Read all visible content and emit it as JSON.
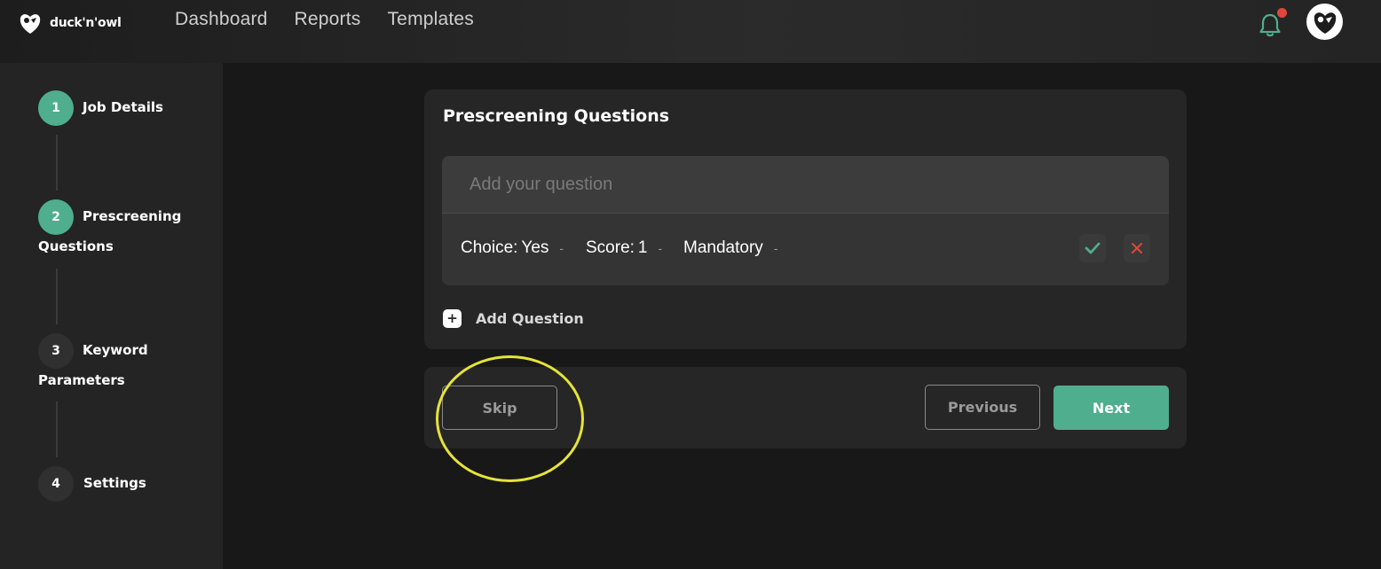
{
  "header": {
    "logo_text": "duck'n'owl",
    "nav": [
      {
        "label": "Dashboard"
      },
      {
        "label": "Reports"
      },
      {
        "label": "Templates"
      }
    ],
    "notification_dot_color": "#e0463c"
  },
  "sidebar": {
    "steps": [
      {
        "number": "1",
        "label": "Job Details",
        "state": "completed"
      },
      {
        "number": "2",
        "label": "Prescreening Questions",
        "state": "current"
      },
      {
        "number": "3",
        "label": "Keyword Parameters",
        "state": "pending"
      },
      {
        "number": "4",
        "label": "Settings",
        "state": "pending"
      }
    ]
  },
  "main": {
    "title": "Prescreening Questions",
    "question": {
      "placeholder": "Add your question",
      "value": "",
      "choice_label": "Choice:",
      "choice_value": "Yes",
      "score_label": "Score:",
      "score_value": "1",
      "mandatory_value": "Mandatory",
      "confirm_icon": "check-icon",
      "delete_icon": "close-icon"
    },
    "add_question_label": "Add Question",
    "footer": {
      "skip_label": "Skip",
      "previous_label": "Previous",
      "next_label": "Next"
    }
  },
  "colors": {
    "accent": "#4fae8d",
    "danger": "#e0463c",
    "highlight": "#e5e33a"
  }
}
